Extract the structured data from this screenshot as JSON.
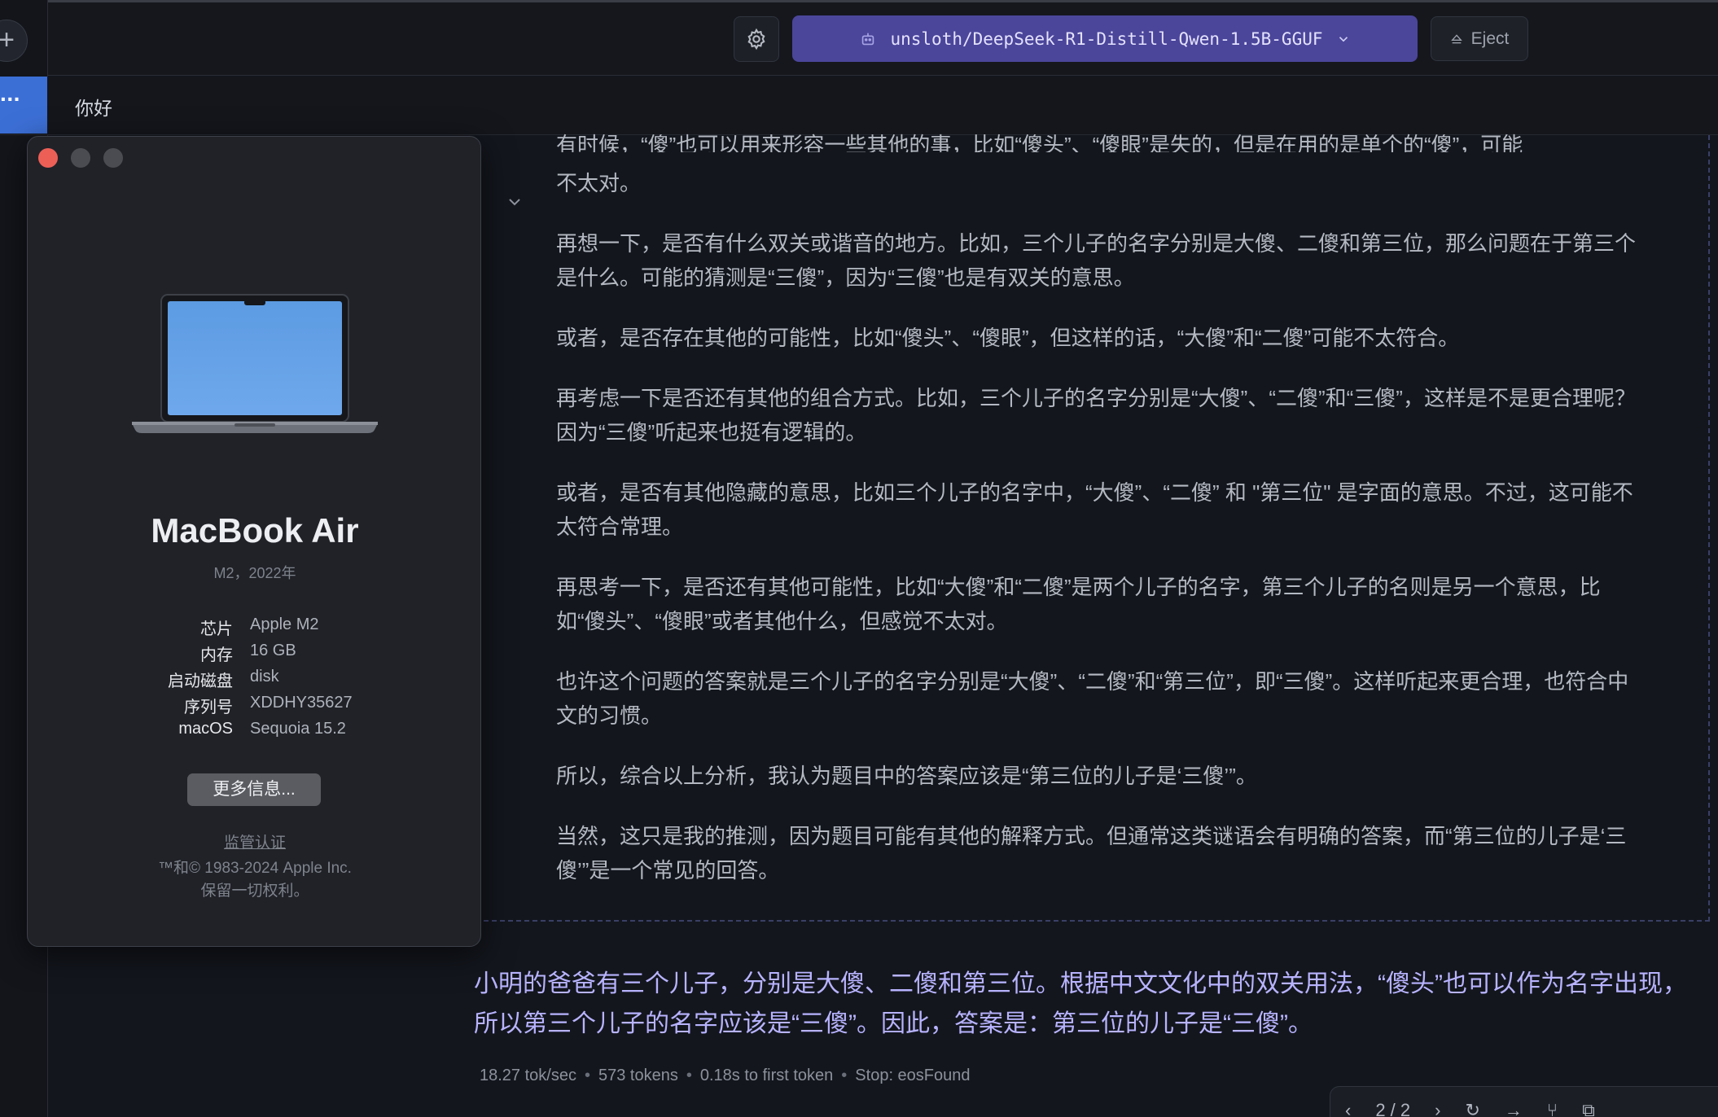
{
  "topbar": {
    "new_symbol": "+",
    "model_name": "unsloth/DeepSeek-R1-Distill-Qwen-1.5B-GGUF",
    "eject_label": "Eject"
  },
  "chat": {
    "menu_symbol": "···",
    "title": "你好",
    "thinking_first_line": "有时候，“傻”也可以用来形容一些其他的事，比如“傻头”、“傻眼”是失的，但是在用的是单个的“傻”，可能",
    "thinking_paragraphs": [
      "不太对。",
      "再想一下，是否有什么双关或谐音的地方。比如，三个儿子的名字分别是大傻、二傻和第三位，那么问题在于第三个是什么。可能的猜测是“三傻”，因为“三傻”也是有双关的意思。",
      "或者，是否存在其他的可能性，比如“傻头”、“傻眼”，但这样的话，“大傻”和“二傻”可能不太符合。",
      "再考虑一下是否还有其他的组合方式。比如，三个儿子的名字分别是“大傻”、“二傻”和“三傻”，这样是不是更合理呢？因为“三傻”听起来也挺有逻辑的。",
      "或者，是否有其他隐藏的意思，比如三个儿子的名字中，“大傻”、“二傻” 和 \"第三位\" 是字面的意思。不过，这可能不太符合常理。",
      "再思考一下，是否还有其他可能性，比如“大傻”和“二傻”是两个儿子的名字，第三个儿子的名则是另一个意思，比如“傻头”、“傻眼”或者其他什么，但感觉不太对。",
      "也许这个问题的答案就是三个儿子的名字分别是“大傻”、“二傻”和“第三位”，即“三傻”。这样听起来更合理，也符合中文的习惯。",
      "所以，综合以上分析，我认为题目中的答案应该是“第三位的儿子是‘三傻’”。",
      "当然，这只是我的推测，因为题目可能有其他的解释方式。但通常这类谜语会有明确的答案，而“第三位的儿子是‘三傻’”是一个常见的回答。"
    ],
    "answer": "小明的爸爸有三个儿子，分别是大傻、二傻和第三位。根据中文文化中的双关用法，“傻头”也可以作为名字出现，所以第三个儿子的名字应该是“三傻”。因此，答案是：第三位的儿子是“三傻”。",
    "stats": {
      "speed": "18.27 tok/sec",
      "tokens": "573 tokens",
      "first_token": "0.18s to first token",
      "stop": "Stop: eosFound"
    },
    "pager": "2 / 2"
  },
  "about": {
    "title": "MacBook Air",
    "subtitle": "M2，2022年",
    "specs": [
      {
        "label": "芯片",
        "value": "Apple M2"
      },
      {
        "label": "内存",
        "value": "16 GB"
      },
      {
        "label": "启动磁盘",
        "value": "disk"
      },
      {
        "label": "序列号",
        "value": "XDDHY35627"
      },
      {
        "label": "macOS",
        "value": "Sequoia 15.2"
      }
    ],
    "more_button": "更多信息...",
    "regulatory_link": "监管认证",
    "copyright": "™和© 1983-2024 Apple Inc.",
    "rights": "保留一切权利。"
  },
  "colors": {
    "accent": "#4b469a",
    "answer_text": "#b8b3ff",
    "close_red": "#ec5f57"
  }
}
